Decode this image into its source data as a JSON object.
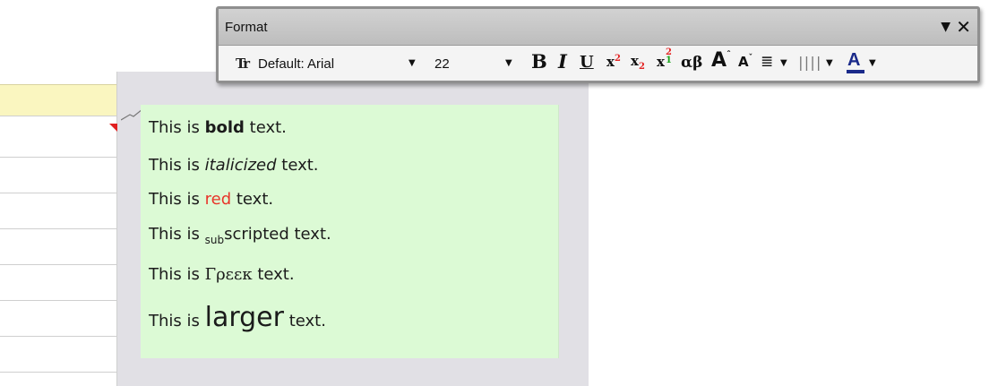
{
  "toolbar": {
    "title": "Format",
    "font_icon": "Tr",
    "font_name": "Default: Arial",
    "font_size": "22",
    "buttons": {
      "bold": "B",
      "italic": "I",
      "underline": "U",
      "superscript_base": "x",
      "superscript_mark": "2",
      "subscript_base": "x",
      "subscript_mark": "2",
      "supsub_base": "x",
      "supsub_upper": "2",
      "supsub_lower": "1",
      "greek": "αβ",
      "grow_font": "A",
      "shrink_font": "A",
      "color_letter": "A"
    },
    "colors": {
      "font_color": "#1a2a8a",
      "accent_red": "#e32626"
    }
  },
  "note": {
    "lines": [
      {
        "prefix": "This is ",
        "styled": "bold",
        "suffix": " text."
      },
      {
        "prefix": "This is ",
        "styled": "italicized",
        "suffix": " text."
      },
      {
        "prefix": "This is ",
        "styled": "red",
        "suffix": " text."
      },
      {
        "prefix": "This is ",
        "styled": "sub",
        "suffix": "scripted text."
      },
      {
        "prefix": "This is ",
        "styled": "Γρεεκ",
        "suffix": " text."
      },
      {
        "prefix": "This is ",
        "styled": "larger",
        "suffix": " text."
      }
    ],
    "background": "#dcfad5",
    "red_color": "#e8352a"
  }
}
